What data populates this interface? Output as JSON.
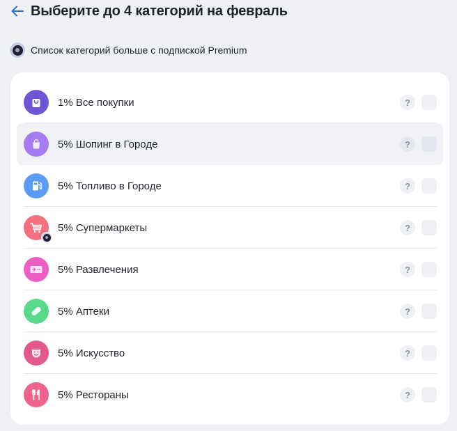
{
  "header": {
    "title": "Выберите до 4 категорий на февраль"
  },
  "premium_note": {
    "text": "Список категорий больше с подпиской Premium"
  },
  "help_symbol": "?",
  "categories": [
    {
      "label": "1% Все покупки",
      "icon": "shopping-bag-icon",
      "color": "#6e55d6",
      "premium": false
    },
    {
      "label": "5% Шопинг в Городе",
      "icon": "shopping-bag-icon",
      "color": "#a57cf2",
      "premium": false
    },
    {
      "label": "5% Топливо в Городе",
      "icon": "fuel-pump-icon",
      "color": "#5b9af5",
      "premium": false
    },
    {
      "label": "5% Супермаркеты",
      "icon": "shopping-cart-icon",
      "color": "#f4707e",
      "premium": true
    },
    {
      "label": "5% Развлечения",
      "icon": "ticket-icon",
      "color": "#ee5fc4",
      "premium": false
    },
    {
      "label": "5% Аптеки",
      "icon": "pill-icon",
      "color": "#58d98c",
      "premium": false
    },
    {
      "label": "5% Искусство",
      "icon": "theater-mask-icon",
      "color": "#e25a8c",
      "premium": false
    },
    {
      "label": "5% Рестораны",
      "icon": "fork-knife-icon",
      "color": "#f0638f",
      "premium": false
    }
  ],
  "colors": {
    "accent": "#2d6fe0",
    "background": "#eef0f3",
    "card": "#ffffff",
    "hover_row": "#f0f2f6"
  },
  "state": {
    "hovered_index": 1
  }
}
